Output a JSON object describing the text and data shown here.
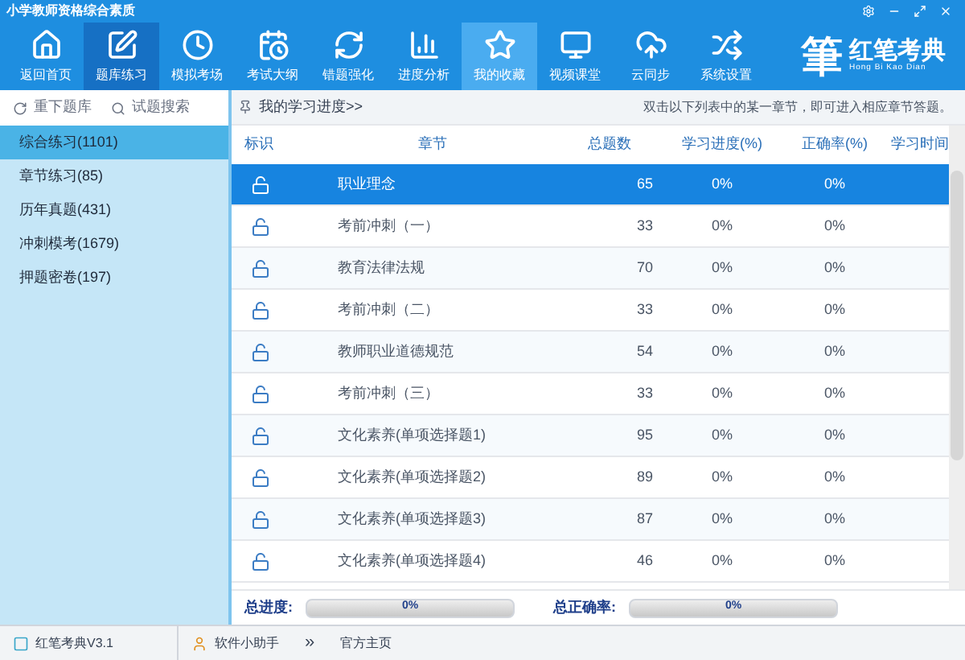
{
  "window": {
    "title": "小学教师资格综合素质"
  },
  "toolbar": [
    {
      "label": "返回首页",
      "selected": false,
      "hover": false,
      "kind": "home"
    },
    {
      "label": "题库练习",
      "selected": true,
      "hover": false,
      "kind": "edit"
    },
    {
      "label": "模拟考场",
      "selected": false,
      "hover": false,
      "kind": "clock"
    },
    {
      "label": "考试大纲",
      "selected": false,
      "hover": false,
      "kind": "calendar"
    },
    {
      "label": "错题强化",
      "selected": false,
      "hover": false,
      "kind": "refresh"
    },
    {
      "label": "进度分析",
      "selected": false,
      "hover": false,
      "kind": "chart"
    },
    {
      "label": "我的收藏",
      "selected": false,
      "hover": true,
      "kind": "star"
    },
    {
      "label": "视频课堂",
      "selected": false,
      "hover": false,
      "kind": "monitor"
    },
    {
      "label": "云同步",
      "selected": false,
      "hover": false,
      "kind": "cloud"
    },
    {
      "label": "系统设置",
      "selected": false,
      "hover": false,
      "kind": "shuffle"
    }
  ],
  "logo": {
    "mark": "筆",
    "name": "红笔考典",
    "subtitle": "Hong Bi Kao Dian"
  },
  "sidebar": {
    "tools": [
      "重下题库",
      "试题搜索"
    ],
    "items": [
      {
        "label": "综合练习(1101)",
        "selected": true
      },
      {
        "label": "章节练习(85)",
        "selected": false
      },
      {
        "label": "历年真题(431)",
        "selected": false
      },
      {
        "label": "冲刺模考(1679)",
        "selected": false
      },
      {
        "label": "押题密卷(197)",
        "selected": false
      }
    ]
  },
  "main": {
    "breadcrumb": "我的学习进度>>",
    "hint": "双击以下列表中的某一章节，即可进入相应章节答题。"
  },
  "table": {
    "columns": [
      "标识",
      "章节",
      "总题数",
      "学习进度(%)",
      "正确率(%)",
      "学习时间"
    ],
    "rows": [
      {
        "chapter": "职业理念",
        "total": "65",
        "progress": "0%",
        "accuracy": "0%",
        "selected": true
      },
      {
        "chapter": "考前冲刺（一）",
        "total": "33",
        "progress": "0%",
        "accuracy": "0%",
        "selected": false
      },
      {
        "chapter": "教育法律法规",
        "total": "70",
        "progress": "0%",
        "accuracy": "0%",
        "selected": false
      },
      {
        "chapter": "考前冲刺（二）",
        "total": "33",
        "progress": "0%",
        "accuracy": "0%",
        "selected": false
      },
      {
        "chapter": "教师职业道德规范",
        "total": "54",
        "progress": "0%",
        "accuracy": "0%",
        "selected": false
      },
      {
        "chapter": "考前冲刺（三）",
        "total": "33",
        "progress": "0%",
        "accuracy": "0%",
        "selected": false
      },
      {
        "chapter": "文化素养(单项选择题1)",
        "total": "95",
        "progress": "0%",
        "accuracy": "0%",
        "selected": false
      },
      {
        "chapter": "文化素养(单项选择题2)",
        "total": "89",
        "progress": "0%",
        "accuracy": "0%",
        "selected": false
      },
      {
        "chapter": "文化素养(单项选择题3)",
        "total": "87",
        "progress": "0%",
        "accuracy": "0%",
        "selected": false
      },
      {
        "chapter": "文化素养(单项选择题4)",
        "total": "46",
        "progress": "0%",
        "accuracy": "0%",
        "selected": false
      }
    ]
  },
  "summary": [
    {
      "label": "总进度:",
      "reading": "0%",
      "level": 0
    },
    {
      "label": "总正确率:",
      "reading": "0%",
      "level": 0
    }
  ],
  "status_bar": {
    "items": [
      "红笔考典V3.1",
      "软件小助手",
      "»",
      "官方主页"
    ]
  }
}
